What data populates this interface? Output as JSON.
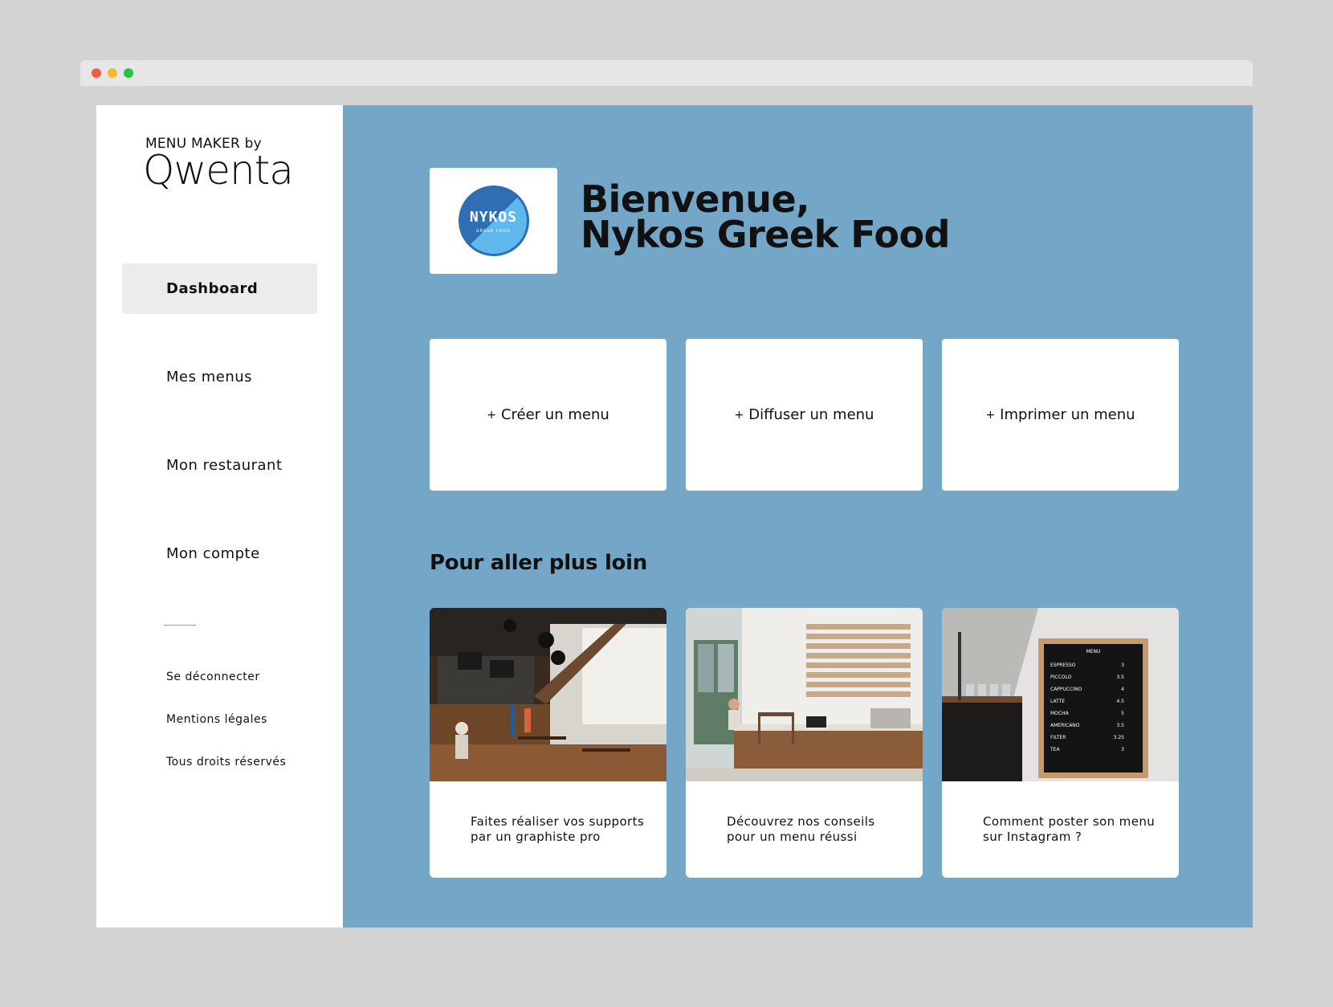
{
  "sidebar": {
    "brand_top": "MENU MAKER by",
    "brand_name": "Qwenta",
    "nav": [
      {
        "label": "Dashboard"
      },
      {
        "label": "Mes menus"
      },
      {
        "label": "Mon restaurant"
      },
      {
        "label": "Mon compte"
      }
    ],
    "footer_links": [
      {
        "label": "Se déconnecter"
      },
      {
        "label": "Mentions légales"
      },
      {
        "label": "Tous droits réservés"
      }
    ]
  },
  "header": {
    "logo_text": "NYKOS",
    "logo_sub": "GREEK FOOD",
    "welcome_line1": "Bienvenue,",
    "welcome_line2": "Nykos Greek Food"
  },
  "actions": [
    {
      "plus": "+",
      "label": "Créer un menu"
    },
    {
      "plus": "+",
      "label": "Diffuser un menu"
    },
    {
      "plus": "+",
      "label": "Imprimer un menu"
    }
  ],
  "section_title": "Pour aller plus loin",
  "articles": [
    {
      "text": "Faites réaliser vos supports par un graphiste pro"
    },
    {
      "text": "Découvrez nos conseils pour un menu réussi"
    },
    {
      "text": "Comment poster son menu sur Instagram ?"
    }
  ],
  "menu_board": {
    "title": "MENU",
    "items": [
      {
        "name": "ESPRESSO",
        "price": "3"
      },
      {
        "name": "PICCOLO",
        "price": "3.5"
      },
      {
        "name": "CAPPUCCINO",
        "price": "4"
      },
      {
        "name": "LATTE",
        "price": "4.5"
      },
      {
        "name": "MOCHA",
        "price": "5"
      },
      {
        "name": "AMERICANO",
        "price": "3.5"
      },
      {
        "name": "FILTER",
        "price": "3.25"
      },
      {
        "name": "TEA",
        "price": "3"
      }
    ]
  },
  "colors": {
    "main_bg": "#74a6c8",
    "page_bg": "#d3d3d3",
    "active_nav": "#ececec"
  }
}
